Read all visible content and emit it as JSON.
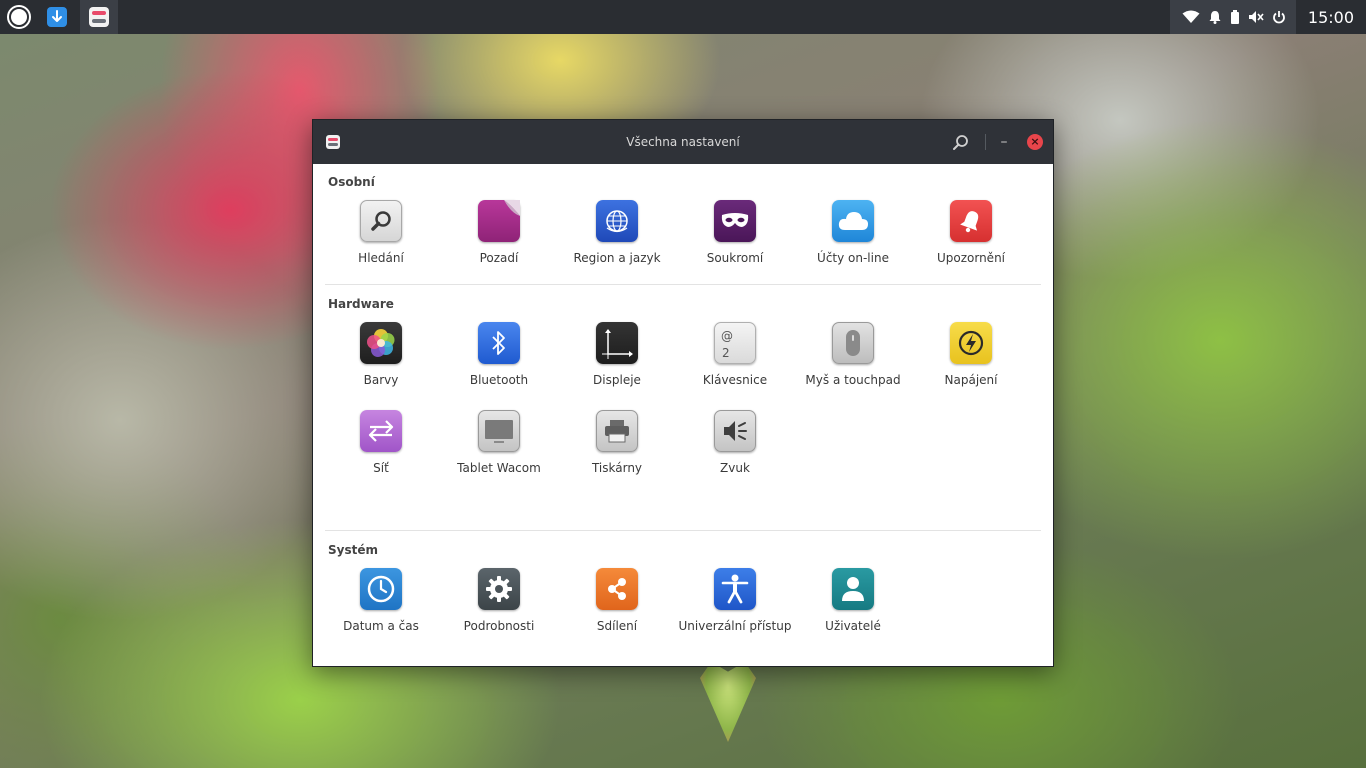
{
  "topbar": {
    "clock": "15:00",
    "left_icons": [
      "home-icon",
      "download-icon",
      "settings-app-icon"
    ],
    "tray_icons": [
      "wifi-icon",
      "bell-icon",
      "battery-icon",
      "volume-muted-icon",
      "power-icon"
    ]
  },
  "window": {
    "title": "Všechna nastavení",
    "buttons": [
      "search-icon",
      "minimize-icon",
      "close-icon"
    ],
    "sections": [
      {
        "title": "Osobní",
        "items": [
          {
            "label": "Hledání",
            "icon": "search-icon",
            "color": "#e8e8e8"
          },
          {
            "label": "Pozadí",
            "icon": "wallpaper-icon",
            "color": "#a52f8c"
          },
          {
            "label": "Region a jazyk",
            "icon": "globe-icon",
            "color": "#2a5bd0"
          },
          {
            "label": "Soukromí",
            "icon": "mask-icon",
            "color": "#5b1f6a"
          },
          {
            "label": "Účty on-line",
            "icon": "cloud-icon",
            "color": "#2e9be8"
          },
          {
            "label": "Upozornění",
            "icon": "bell-icon",
            "color": "#e6403f"
          }
        ]
      },
      {
        "title": "Hardware",
        "items": [
          {
            "label": "Barvy",
            "icon": "color-wheel-icon",
            "color": "#2b2b2b"
          },
          {
            "label": "Bluetooth",
            "icon": "bluetooth-icon",
            "color": "#2f6fe0"
          },
          {
            "label": "Displeje",
            "icon": "display-icon",
            "color": "#2b2b2b"
          },
          {
            "label": "Klávesnice",
            "icon": "keyboard-icon",
            "color": "#e8e8e8"
          },
          {
            "label": "Myš a touchpad",
            "icon": "mouse-icon",
            "color": "#cfcfcf"
          },
          {
            "label": "Napájení",
            "icon": "power-lightning-icon",
            "color": "#f3d33a"
          },
          {
            "label": "Síť",
            "icon": "network-icon",
            "color": "#b46ad6"
          },
          {
            "label": "Tablet Wacom",
            "icon": "tablet-icon",
            "color": "#d8d8d8"
          },
          {
            "label": "Tiskárny",
            "icon": "printer-icon",
            "color": "#d8d8d8"
          },
          {
            "label": "Zvuk",
            "icon": "speaker-icon",
            "color": "#d8d8d8"
          }
        ]
      },
      {
        "title": "Systém",
        "items": [
          {
            "label": "Datum a čas",
            "icon": "clock-icon",
            "color": "#2a86d6"
          },
          {
            "label": "Podrobnosti",
            "icon": "gear-icon",
            "color": "#4a5358"
          },
          {
            "label": "Sdílení",
            "icon": "share-icon",
            "color": "#ef7a2c"
          },
          {
            "label": "Univerzální přístup",
            "icon": "accessibility-icon",
            "color": "#2f6fe0"
          },
          {
            "label": "Uživatelé",
            "icon": "user-icon",
            "color": "#1f8a92"
          }
        ]
      }
    ]
  }
}
